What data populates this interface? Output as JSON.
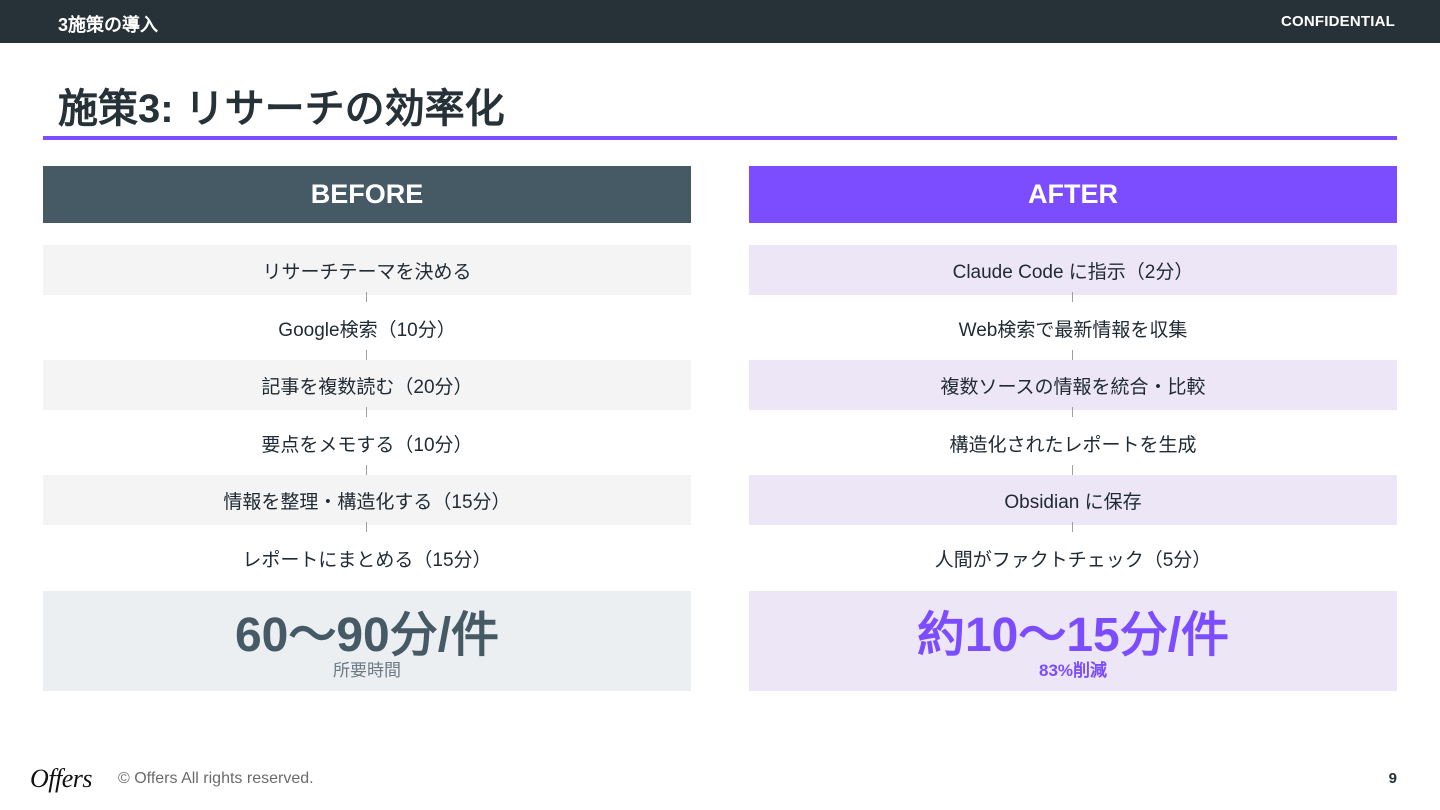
{
  "header": {
    "section": "3施策の導入",
    "confidential": "CONFIDENTIAL"
  },
  "title": "施策3: リサーチの効率化",
  "before": {
    "label": "BEFORE",
    "steps": [
      "リサーチテーマを決める",
      "Google検索（10分）",
      "記事を複数読む（20分）",
      "要点をメモする（10分）",
      "情報を整理・構造化する（15分）",
      "レポートにまとめる（15分）"
    ],
    "summary_value": "60〜90分/件",
    "summary_caption": "所要時間"
  },
  "after": {
    "label": "AFTER",
    "steps": [
      "Claude Code に指示（2分）",
      "Web検索で最新情報を収集",
      "複数ソースの情報を統合・比較",
      "構造化されたレポートを生成",
      "Obsidian に保存",
      "人間がファクトチェック（5分）"
    ],
    "summary_value": "約10〜15分/件",
    "summary_caption": "83%削減"
  },
  "footer": {
    "logo": "Offers",
    "copyright": "© Offers All rights reserved.",
    "page": "9"
  },
  "colors": {
    "header_bg": "#263238",
    "accent": "#7c4dff",
    "before_head": "#465a65",
    "after_tint": "#ede6f6"
  }
}
